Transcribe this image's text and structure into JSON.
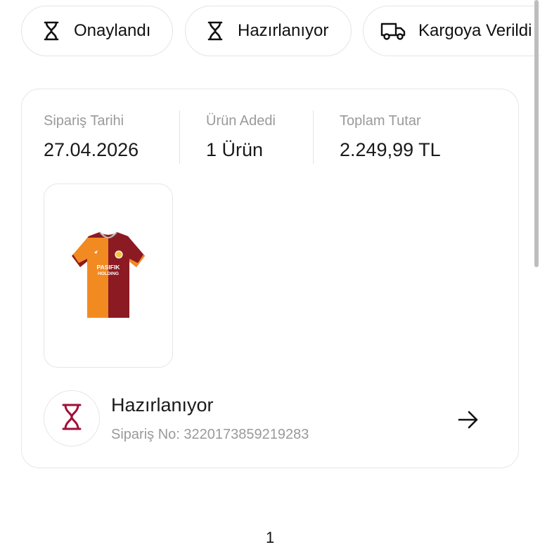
{
  "filters": [
    {
      "label": "Onaylandı",
      "icon": "hourglass-icon"
    },
    {
      "label": "Hazırlanıyor",
      "icon": "hourglass-icon"
    },
    {
      "label": "Kargoya Verildi",
      "icon": "truck-icon"
    }
  ],
  "order": {
    "date_label": "Sipariş Tarihi",
    "date_value": "27.04.2026",
    "count_label": "Ürün Adedi",
    "count_value": "1 Ürün",
    "total_label": "Toplam Tutar",
    "total_value": "2.249,99 TL",
    "product": {
      "image": "galatasaray-jersey",
      "sponsor_line1": "PASIFIK",
      "sponsor_line2": "HOLDING"
    },
    "status": "Hazırlanıyor",
    "order_no": "Sipariş No: 3220173859219283",
    "status_icon": "hourglass-icon",
    "status_color": "#a01038"
  },
  "pagination": {
    "current": "1"
  },
  "colors": {
    "accent": "#a01038",
    "border": "#e6e6e6",
    "muted": "#9a9a9a"
  }
}
